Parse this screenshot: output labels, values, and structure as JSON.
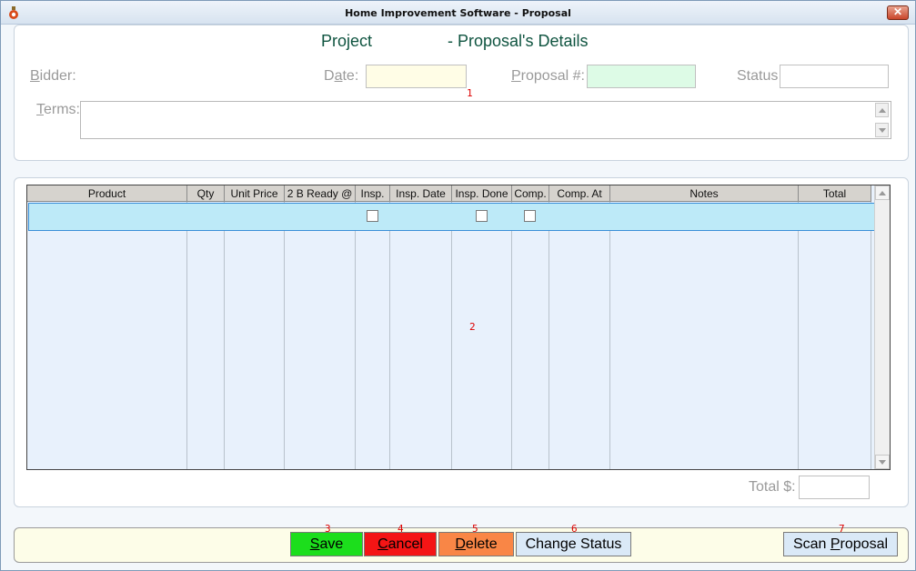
{
  "window": {
    "title": "Home Improvement Software - Proposal",
    "close_symbol": "✕"
  },
  "header": {
    "project_label": "Project",
    "details_label": "- Proposal's Details",
    "bidder_label_first": "B",
    "bidder_label_rest": "idder:",
    "date_label_first": "Date:",
    "proposal_label_first": "P",
    "proposal_label_rest": "roposal #:",
    "status_label": "Status",
    "terms_label_first": "T",
    "terms_label_rest": "erms:",
    "date_value": "",
    "proposal_value": "",
    "status_value": "",
    "terms_value": ""
  },
  "grid": {
    "columns": [
      "Product",
      "Qty",
      "Unit Price",
      "2 B Ready @",
      "Insp.",
      "Insp. Date",
      "Insp. Done",
      "Comp.",
      "Comp. At",
      "Notes",
      "Total"
    ],
    "total_label": "Total $:",
    "total_value": ""
  },
  "markers": [
    "1",
    "2",
    "3",
    "4",
    "5",
    "6",
    "7"
  ],
  "buttons": {
    "save_first": "S",
    "save_rest": "ave",
    "cancel_first": "C",
    "cancel_rest": "ancel",
    "delete_first": "D",
    "delete_rest": "elete",
    "change_status": "Change Status",
    "scan_pre": "Scan ",
    "scan_first": "P",
    "scan_rest": "roposal"
  },
  "colors": {
    "date_field": "#fffde6",
    "proposal_field": "#ddfbe6",
    "save": "#1cde1c",
    "cancel": "#f41515",
    "delete": "#f98646",
    "change_status": "#dae9f7",
    "scan": "#dae9f7",
    "heading": "#0f5440"
  }
}
